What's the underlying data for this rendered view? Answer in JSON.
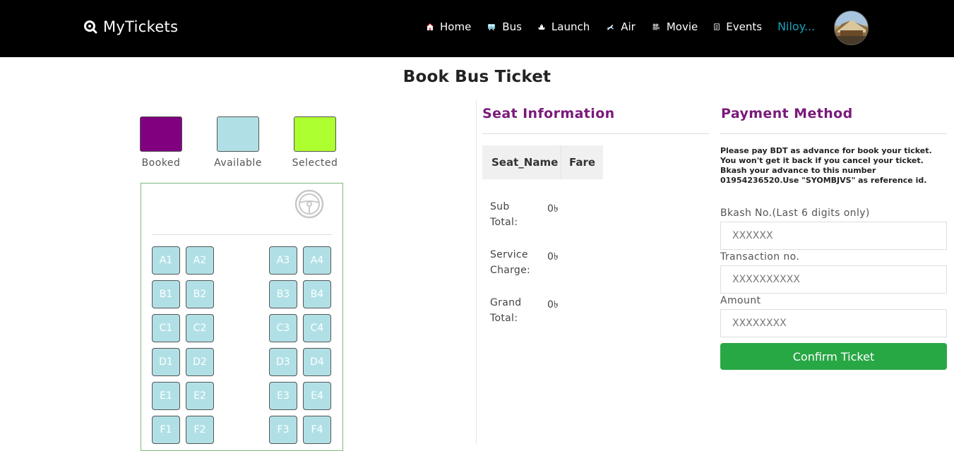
{
  "brand": {
    "name": "MyTickets",
    "icon": "search-icon"
  },
  "nav": {
    "items": [
      {
        "label": "Home",
        "icon": "home-icon"
      },
      {
        "label": "Bus",
        "icon": "bus-icon"
      },
      {
        "label": "Launch",
        "icon": "ship-icon"
      },
      {
        "label": "Air",
        "icon": "plane-icon"
      },
      {
        "label": "Movie",
        "icon": "film-icon"
      },
      {
        "label": "Events",
        "icon": "ticket-icon"
      }
    ],
    "user": "Niloy..."
  },
  "page": {
    "title": "Book Bus Ticket"
  },
  "legend": {
    "booked": {
      "label": "Booked",
      "color": "#800080"
    },
    "available": {
      "label": "Available",
      "color": "#b0e0e6"
    },
    "selected": {
      "label": "Selected",
      "color": "#adff2f"
    }
  },
  "seats": {
    "rows": [
      [
        "A1",
        "A2",
        "A3",
        "A4"
      ],
      [
        "B1",
        "B2",
        "B3",
        "B4"
      ],
      [
        "C1",
        "C2",
        "C3",
        "C4"
      ],
      [
        "D1",
        "D2",
        "D3",
        "D4"
      ],
      [
        "E1",
        "E2",
        "E3",
        "E4"
      ],
      [
        "F1",
        "F2",
        "F3",
        "F4"
      ]
    ]
  },
  "seat_info": {
    "title": "Seat Information",
    "columns": [
      "Seat_Name",
      "Fare"
    ],
    "sub_total_label": "Sub Total:",
    "sub_total_value": "0৳",
    "service_charge_label": "Service Charge:",
    "service_charge_value": "0৳",
    "grand_total_label": "Grand Total:",
    "grand_total_value": "0৳"
  },
  "payment": {
    "title": "Payment Method",
    "note_line1": "Please pay BDT as advance for book your ticket.",
    "note_line2": "You won't get it back if you cancel your ticket.",
    "note_line3": "Bkash your advance to this number",
    "note_line4": "01954236520.Use \"SYOMBJVS\" as reference id.",
    "bkash_label": "Bkash No.(Last 6 digits only)",
    "bkash_placeholder": "XXXXXX",
    "trx_label": "Transaction no.",
    "trx_placeholder": "XXXXXXXXXX",
    "amount_label": "Amount",
    "amount_placeholder": "XXXXXXXX",
    "confirm_label": "Confirm Ticket"
  }
}
